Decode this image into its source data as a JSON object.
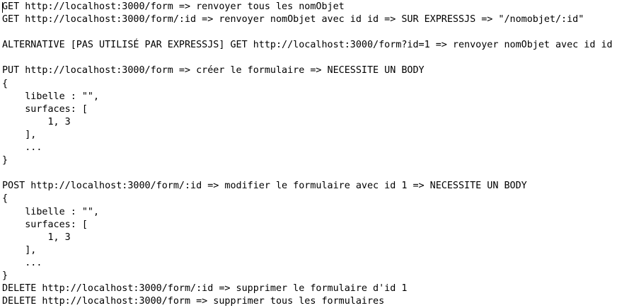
{
  "editor": {
    "lines": [
      "GET http://localhost:3000/form => renvoyer tous les nomObjet",
      "GET http://localhost:3000/form/:id => renvoyer nomObjet avec id id => SUR EXPRESSJS => \"/nomobjet/:id\"",
      "",
      "ALTERNATIVE [PAS UTILISÉ PAR EXPRESSJS] GET http://localhost:3000/form?id=1 => renvoyer nomObjet avec id id",
      "",
      "PUT http://localhost:3000/form => créer le formulaire => NECESSITE UN BODY",
      "{",
      "    libelle : \"\",",
      "    surfaces: [",
      "        1, 3",
      "    ],",
      "    ...",
      "}",
      "",
      "POST http://localhost:3000/form/:id => modifier le formulaire avec id 1 => NECESSITE UN BODY",
      "{",
      "    libelle : \"\",",
      "    surfaces: [",
      "        1, 3",
      "    ],",
      "    ...",
      "}",
      "DELETE http://localhost:3000/form/:id => supprimer le formulaire d'id 1",
      "DELETE http://localhost:3000/form => supprimer tous les formulaires"
    ]
  }
}
